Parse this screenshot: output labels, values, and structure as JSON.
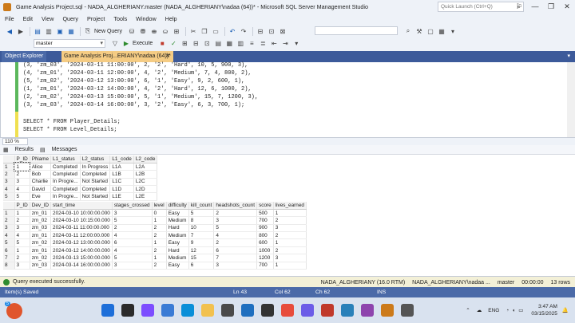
{
  "window": {
    "title": "Game Analysis Project.sql - NADA_ALGHERIANY.master (NADA_ALGHERIANY\\nadaa (64))* - Microsoft SQL Server Management Studio",
    "quick_launch_placeholder": "Quick Launch (Ctrl+Q)"
  },
  "menu": [
    "File",
    "Edit",
    "View",
    "Query",
    "Project",
    "Tools",
    "Window",
    "Help"
  ],
  "toolbar": {
    "new_query": "New Query",
    "execute": "Execute",
    "database": "master"
  },
  "tabs": {
    "object_explorer": "Object Explorer",
    "query_tab": "Game Analysis Proj...ERIANY\\nadaa (64))*",
    "close": "✕"
  },
  "editor": {
    "lines": [
      "(3, 'zm_03', '2024-03-11 11:00:00', 2, '2', 'Hard', 10, 5, 900, 3),",
      "(4, 'zm_01', '2024-03-11 12:00:00', 4, '2', 'Medium', 7, 4, 800, 2),",
      "(5, 'zm_02', '2024-03-12 13:00:00', 6, '1', 'Easy', 9, 2, 600, 1),",
      "(1, 'zm_01', '2024-03-12 14:00:00', 4, '2', 'Hard', 12, 6, 1000, 2),",
      "(2, 'zm_02', '2024-03-13 15:00:00', 5, '1', 'Medium', 15, 7, 1200, 3),",
      "(3, 'zm_03', '2024-03-14 16:00:00', 3, '2', 'Easy', 6, 3, 700, 1);",
      "",
      "SELECT * FROM Player_Details;",
      "SELECT * FROM Level_Details;"
    ],
    "zoom": "110 %"
  },
  "results_tabs": {
    "results": "Results",
    "messages": "Messages"
  },
  "player_table": {
    "headers": [
      "P_ID",
      "PName",
      "L1_status",
      "L2_status",
      "L1_code",
      "L2_code"
    ],
    "rows": [
      [
        "1",
        "Alice",
        "Completed",
        "In Progress",
        "L1A",
        "L2A"
      ],
      [
        "2",
        "Bob",
        "Completed",
        "Completed",
        "L1B",
        "L2B"
      ],
      [
        "3",
        "Charlie",
        "In Progre...",
        "Not Started",
        "L1C",
        "L2C"
      ],
      [
        "4",
        "David",
        "Completed",
        "Completed",
        "L1D",
        "L2D"
      ],
      [
        "5",
        "Eve",
        "In Progre...",
        "Not Started",
        "L1E",
        "L2E"
      ]
    ]
  },
  "level_table": {
    "headers": [
      "P_ID",
      "Dev_ID",
      "start_time",
      "stages_crossed",
      "level",
      "difficulty",
      "kill_count",
      "headshots_count",
      "score",
      "lives_earned"
    ],
    "rows": [
      [
        "1",
        "zm_01",
        "2024-03-10 10:00:00.000",
        "3",
        "0",
        "Easy",
        "5",
        "2",
        "500",
        "1"
      ],
      [
        "2",
        "zm_02",
        "2024-03-10 10:15:00.000",
        "5",
        "1",
        "Medium",
        "8",
        "3",
        "700",
        "2"
      ],
      [
        "3",
        "zm_03",
        "2024-03-11 11:00:00.000",
        "2",
        "2",
        "Hard",
        "10",
        "5",
        "900",
        "3"
      ],
      [
        "4",
        "zm_01",
        "2024-03-11 12:00:00.000",
        "4",
        "2",
        "Medium",
        "7",
        "4",
        "800",
        "2"
      ],
      [
        "5",
        "zm_02",
        "2024-03-12 13:00:00.000",
        "6",
        "1",
        "Easy",
        "9",
        "2",
        "600",
        "1"
      ],
      [
        "1",
        "zm_01",
        "2024-03-12 14:00:00.000",
        "4",
        "2",
        "Hard",
        "12",
        "6",
        "1000",
        "2"
      ],
      [
        "2",
        "zm_02",
        "2024-03-13 15:00:00.000",
        "5",
        "1",
        "Medium",
        "15",
        "7",
        "1200",
        "3"
      ],
      [
        "3",
        "zm_03",
        "2024-03-14 16:00:00.000",
        "3",
        "2",
        "Easy",
        "6",
        "3",
        "700",
        "1"
      ]
    ]
  },
  "query_status": {
    "message": "Query executed successfully.",
    "server": "NADA_ALGHERIANY (16.0 RTM)",
    "user": "NADA_ALGHERIANY\\nadaa ...",
    "database": "master",
    "elapsed": "00:00:00",
    "rows": "13 rows"
  },
  "statusbar": {
    "saved": "Item(s) Saved",
    "ln": "Ln 43",
    "col": "Col 62",
    "ch": "Ch 62",
    "mode": "INS"
  },
  "taskbar": {
    "weather_badge": "5",
    "language": "ENG",
    "time": "3:47 AM",
    "date": "03/15/2025"
  },
  "colors": {
    "accent": "#3c5a9a",
    "active_tab": "#f5cc84",
    "status_ok": "#2e8b2e"
  }
}
